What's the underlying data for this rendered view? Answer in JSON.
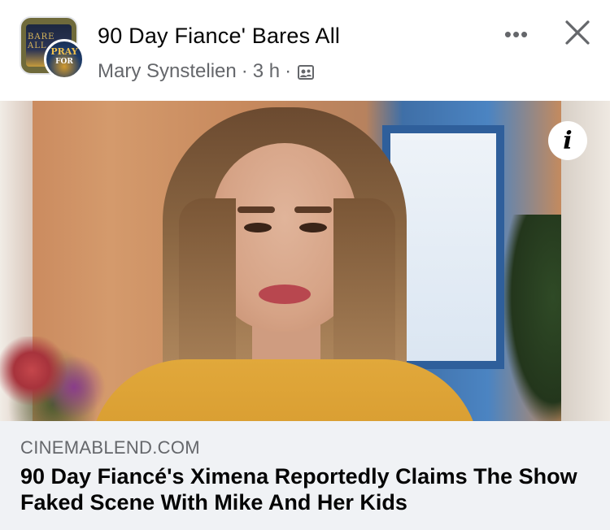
{
  "post_header": {
    "group_name": "90 Day Fiance' Bares All",
    "group_avatar_text": "BARE ALL",
    "user_avatar_text_top": "PRAY",
    "user_avatar_text_bottom": "FOR",
    "author": "Mary Synstelien",
    "separator": "·",
    "time": "3 h",
    "privacy_icon": "group-privacy-icon",
    "more_label": "•••",
    "close_icon": "close-icon"
  },
  "photo": {
    "info_label": "i",
    "info_icon": "info-icon"
  },
  "link_preview": {
    "domain": "CINEMABLEND.COM",
    "title": "90 Day Fiancé's Ximena Reportedly Claims The Show Faked Scene With Mike And Her Kids"
  },
  "colors": {
    "secondary_text": "#65676b",
    "primary_text": "#050505",
    "card_background": "#f0f2f5"
  }
}
